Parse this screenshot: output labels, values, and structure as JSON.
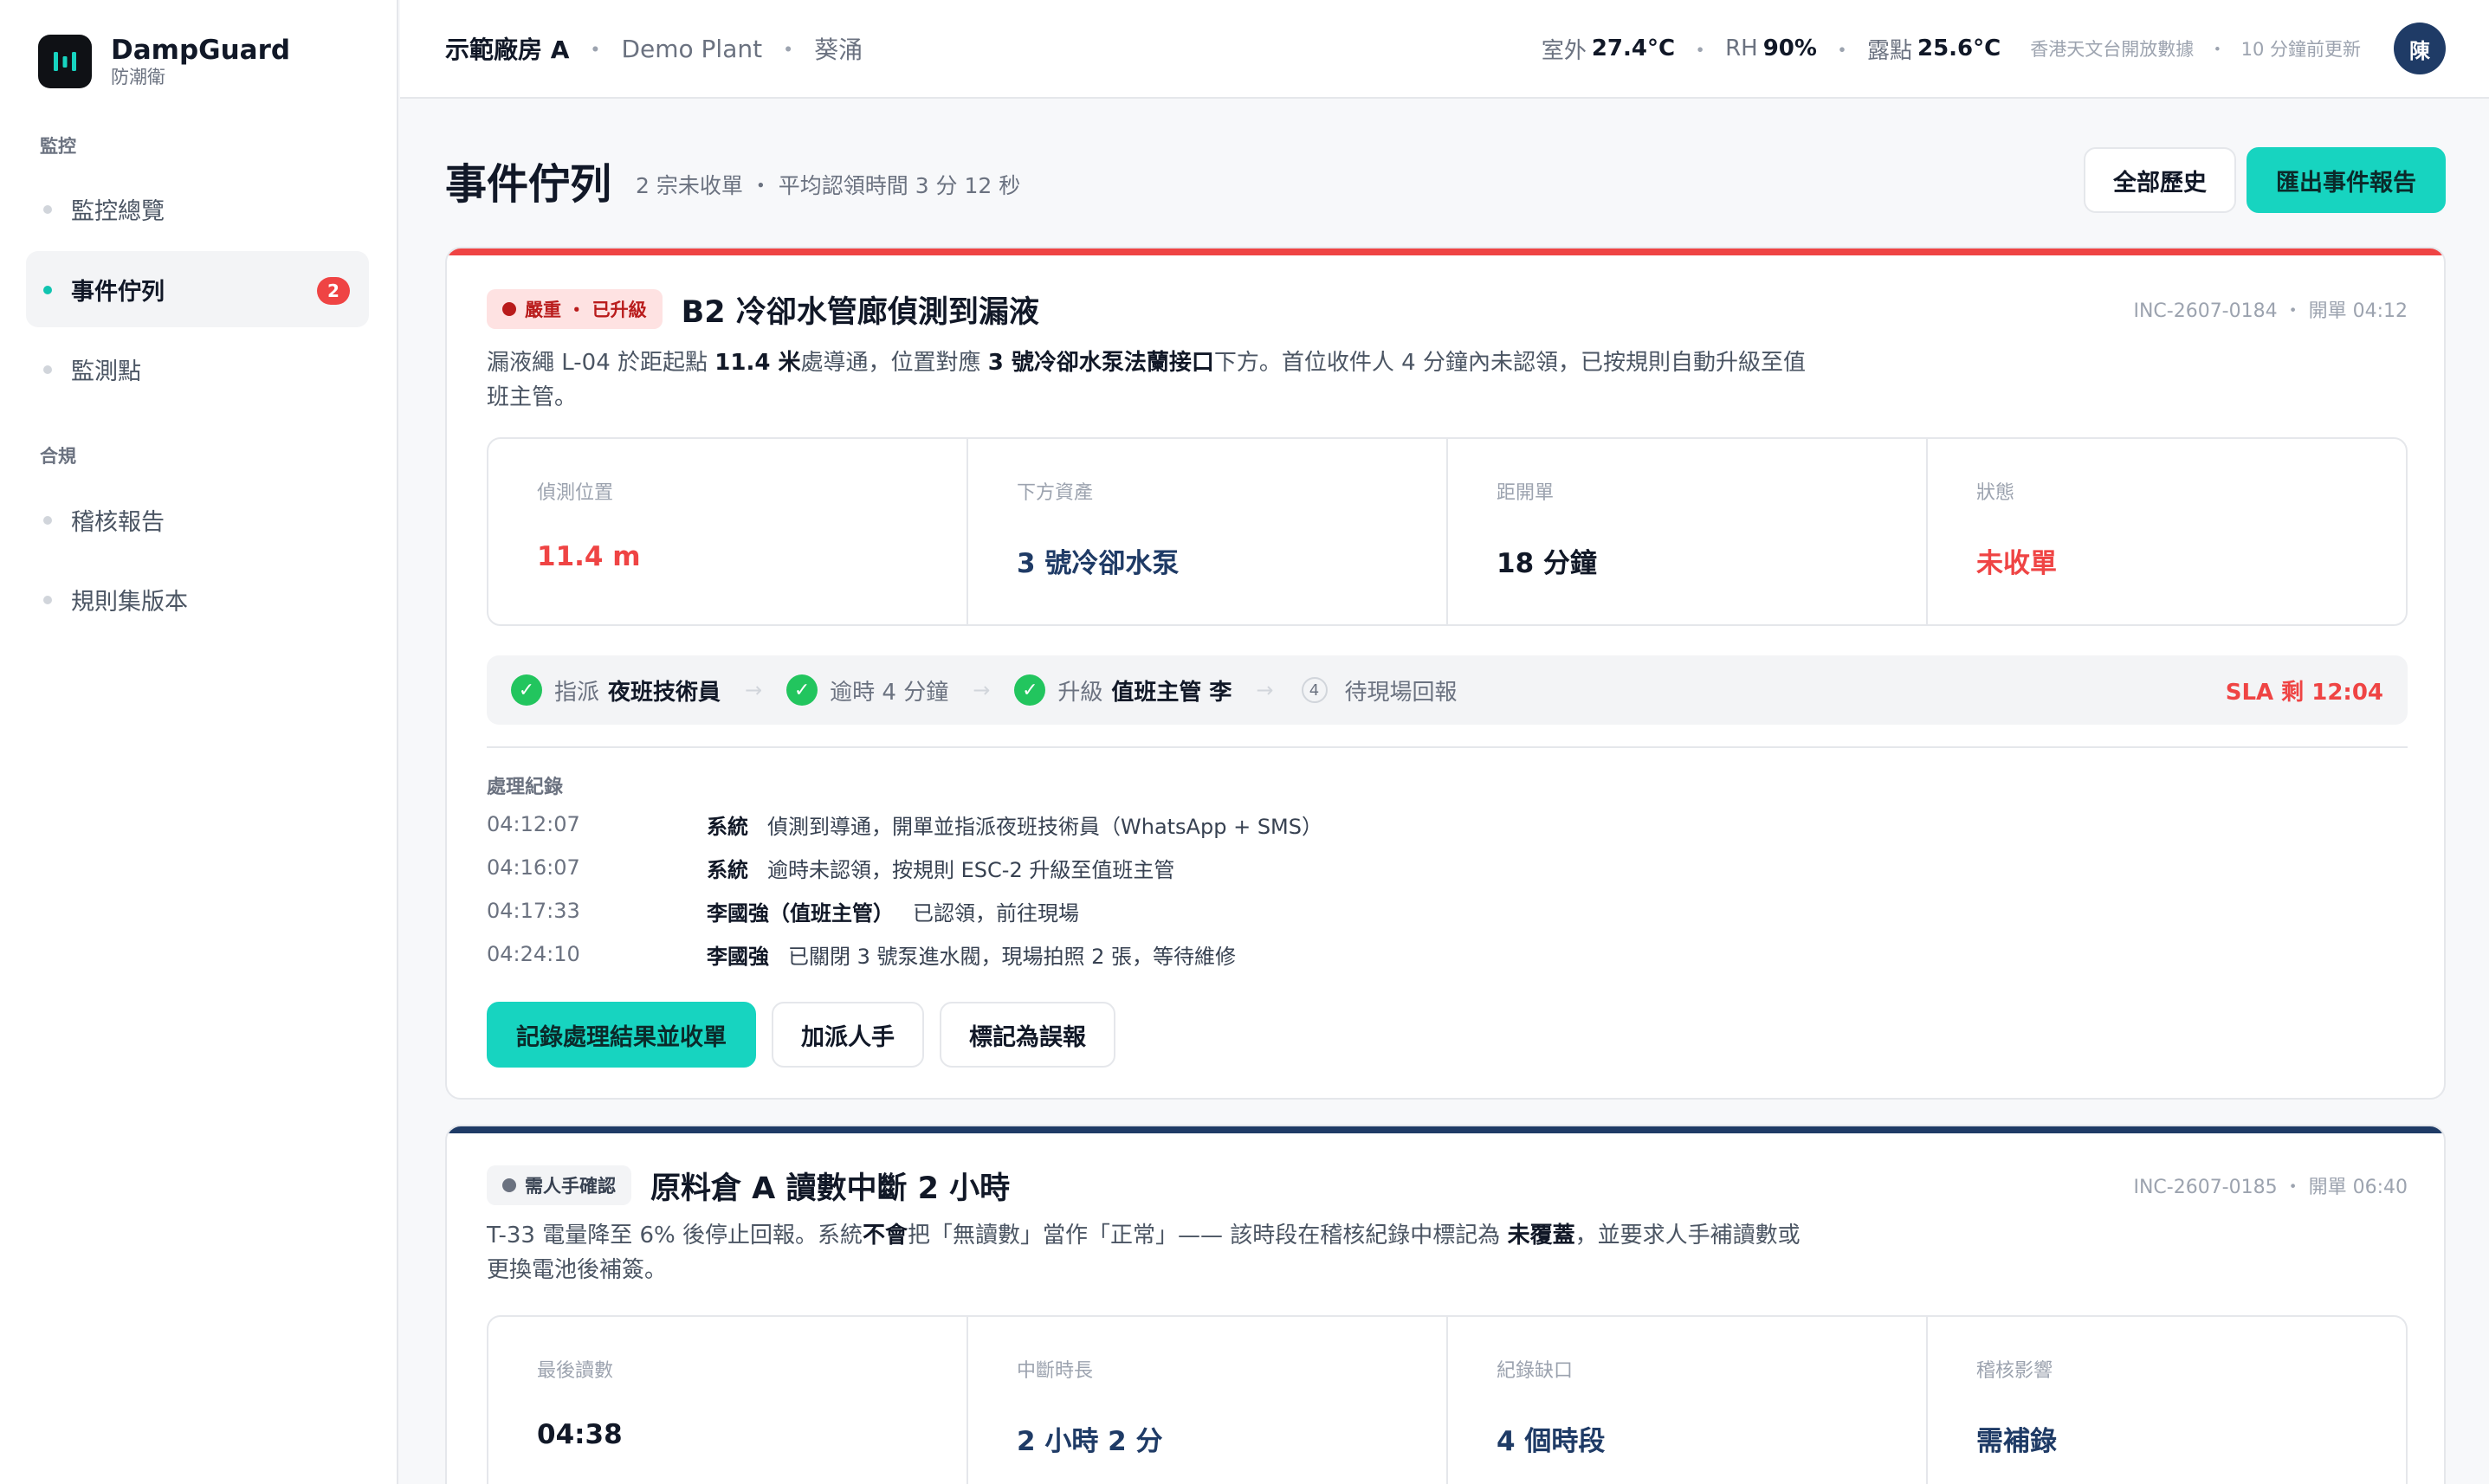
{
  "brand": {
    "name": "DampGuard",
    "sub": "防潮衛"
  },
  "sidebar": {
    "sections": [
      {
        "title": "監控",
        "items": [
          {
            "label": "監控總覽"
          },
          {
            "label": "事件佇列",
            "badge": "2"
          },
          {
            "label": "監測點"
          }
        ]
      },
      {
        "title": "合規",
        "items": [
          {
            "label": "稽核報告"
          },
          {
            "label": "規則集版本"
          }
        ]
      }
    ]
  },
  "topbar": {
    "plant": "示範廠房 A",
    "plant_en": "Demo Plant",
    "district": "葵涌",
    "outdoor_label": "室外",
    "outdoor_temp": "27.4°C",
    "rh_label": "RH",
    "rh_value": "90%",
    "dew_label": "露點",
    "dew_value": "25.6°C",
    "source": "香港天文台開放數據",
    "updated": "10 分鐘前更新",
    "avatar": "陳"
  },
  "page": {
    "title": "事件佇列",
    "subtitle": "2 宗未收單 ・ 平均認領時間 3 分 12 秒",
    "history_button": "全部歷史",
    "export_button": "匯出事件報告"
  },
  "incidents": [
    {
      "tag": "嚴重 ・ 已升級",
      "title": "B2 冷卻水管廊偵測到漏液",
      "meta": "INC-2607-0184 ・ 開單 04:12",
      "desc": {
        "p1": "漏液繩 L-04 於距起點 ",
        "b1": "11.4 米",
        "p2": "處導通，位置對應 ",
        "b2": "3 號冷卻水泵法蘭接口",
        "p3": "下方。首位收件人 4 分鐘內未認領，已按規則自動升級至值班主管。"
      },
      "stats": [
        {
          "label": "偵測位置",
          "value": "11.4 m"
        },
        {
          "label": "下方資產",
          "value": "3 號冷卻水泵"
        },
        {
          "label": "距開單",
          "value": "18 分鐘"
        },
        {
          "label": "狀態",
          "value": "未收單"
        }
      ],
      "steps": {
        "s1_label": "指派",
        "s1_value": "夜班技術員",
        "s2_label": "逾時 4 分鐘",
        "s3_label": "升級",
        "s3_value": "值班主管 李",
        "s4_num": "4",
        "s4_label": "待現場回報"
      },
      "sla": "SLA 剩 12:04",
      "log_title": "處理紀錄",
      "log": [
        {
          "time": "04:12:07",
          "actor": "系統",
          "text": "偵測到導通，開單並指派夜班技術員（WhatsApp + SMS）"
        },
        {
          "time": "04:16:07",
          "actor": "系統",
          "text": "逾時未認領，按規則 ESC-2 升級至值班主管"
        },
        {
          "time": "04:17:33",
          "actor": "李國強（值班主管）",
          "text": "已認領，前往現場"
        },
        {
          "time": "04:24:10",
          "actor": "李國強",
          "text": "已關閉 3 號泵進水閥，現場拍照 2 張，等待維修"
        }
      ],
      "actions": [
        "記錄處理結果並收單",
        "加派人手",
        "標記為誤報"
      ]
    },
    {
      "tag": "需人手確認",
      "title": "原料倉 A 讀數中斷 2 小時",
      "meta": "INC-2607-0185 ・ 開單 06:40",
      "desc": {
        "p1": "T-33 電量降至 6% 後停止回報。系統",
        "b1": "不會",
        "p2": "把「無讀數」當作「正常」—— 該時段在稽核紀錄中標記為 ",
        "b2": "未覆蓋",
        "p3": "，並要求人手補讀數或更換電池後補簽。"
      },
      "stats": [
        {
          "label": "最後讀數",
          "value": "04:38"
        },
        {
          "label": "中斷時長",
          "value": "2 小時 2 分"
        },
        {
          "label": "紀錄缺口",
          "value": "4 個時段"
        },
        {
          "label": "稽核影響",
          "value": "需補錄"
        }
      ]
    }
  ],
  "colors": {
    "accent": "#17d4c0",
    "danger": "#ef4444",
    "navy": "#1f3b66",
    "success": "#22c55e"
  }
}
